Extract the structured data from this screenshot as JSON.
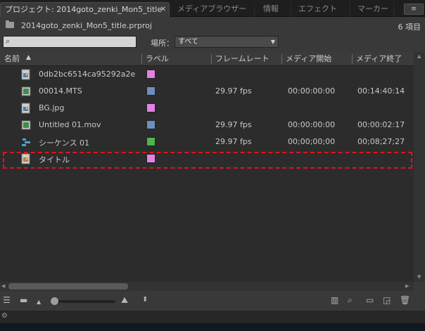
{
  "tabs": [
    {
      "label": "プロジェクト: 2014goto_zenki_Mon5_title",
      "close": "✕"
    },
    {
      "label": "メディアブラウザー"
    },
    {
      "label": "情報"
    },
    {
      "label": "エフェクト"
    },
    {
      "label": "マーカー"
    }
  ],
  "panel_menu_icon": "≡",
  "project": {
    "name": "2014goto_zenki_Mon5_title.prproj",
    "count": "6 項目"
  },
  "search": {
    "glyph": "⌕",
    "value": ""
  },
  "filter": {
    "label": "場所：",
    "value": "すべて",
    "arrow": "▼"
  },
  "columns": [
    {
      "label": "名前",
      "sort": "▲"
    },
    {
      "label": "ラベル"
    },
    {
      "label": "フレームレート"
    },
    {
      "label": "メディア開始"
    },
    {
      "label": "メディア終了"
    }
  ],
  "items": [
    {
      "name": "0db2bc6514ca95292a2e",
      "label_color": "#e482e4",
      "fps": "",
      "start": "",
      "end": "",
      "icon": "image-file-icon"
    },
    {
      "name": "00014.MTS",
      "label_color": "#6f8ec0",
      "fps": "29.97 fps",
      "start": "00:00:00:00",
      "end": "00:14:40:14",
      "icon": "video-clip-icon"
    },
    {
      "name": "BG.jpg",
      "label_color": "#e482e4",
      "fps": "",
      "start": "",
      "end": "",
      "icon": "image-file-icon"
    },
    {
      "name": "Untitled 01.mov",
      "label_color": "#6f8ec0",
      "fps": "29.97 fps",
      "start": "00:00:00:00",
      "end": "00:00:02:17",
      "icon": "video-clip-icon"
    },
    {
      "name": "シーケンス 01",
      "label_color": "#4cb54c",
      "fps": "29.97 fps",
      "start": "00;00;00;00",
      "end": "00;08;27;27",
      "icon": "sequence-icon"
    },
    {
      "name": "タイトル",
      "label_color": "#e482e4",
      "fps": "",
      "start": "",
      "end": "",
      "icon": "title-file-icon"
    }
  ]
}
